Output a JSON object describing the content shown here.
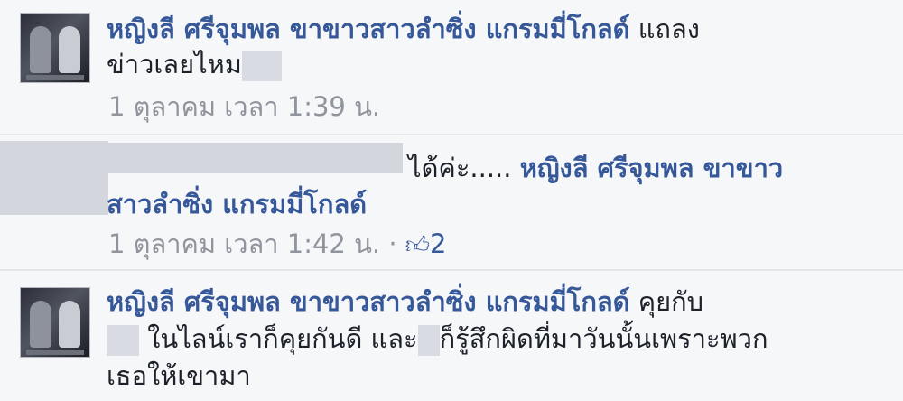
{
  "comments": [
    {
      "author": "หญิงลี ศรีจุมพล ขาขาวสาวลำซิ่ง แกรมมี่โกลด์",
      "text_line1_tail": "แถลง",
      "text_line2": "ข่าวเลยไหม",
      "timestamp": "1 ตุลาคม เวลา 1:39 น."
    },
    {
      "text_prefix": "ได้ค่ะ.....",
      "mention_line1": "หญิงลี ศรีจุมพล ขาขาว",
      "mention_line2": "สาวลำซิ่ง แกรมมี่โกลด์",
      "timestamp": "1 ตุลาคม เวลา 1:42 น. ·",
      "likes": "2",
      "like_icon": "thumbs-up-icon"
    },
    {
      "author": "หญิงลี ศรีจุมพล ขาขาวสาวลำซิ่ง แกรมมี่โกลด์",
      "text_line1_tail": "คุยกับ",
      "text_line2_a": "ในไลน์เราก็คุยกันดี และ",
      "text_line2_b": "ก็รู้สึกผิดที่มาวันนั้นเพราะพวก",
      "text_line3": "เธอให้เขามา"
    }
  ]
}
